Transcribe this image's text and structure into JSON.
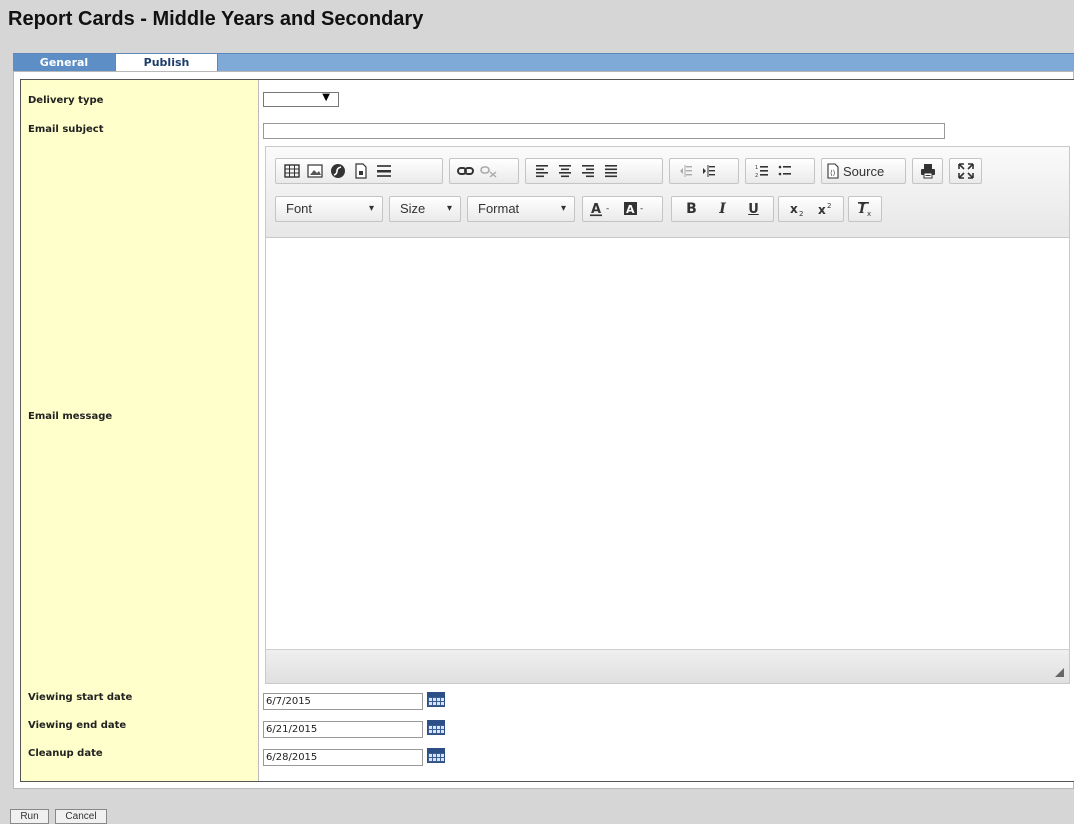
{
  "page": {
    "title": "Report Cards - Middle Years and Secondary"
  },
  "tabs": [
    {
      "label": "General"
    },
    {
      "label": "Publish"
    }
  ],
  "form": {
    "delivery_type": {
      "label": "Delivery type",
      "value": ""
    },
    "email_subject": {
      "label": "Email subject",
      "value": ""
    },
    "email_message": {
      "label": "Email message"
    },
    "viewing_start_date": {
      "label": "Viewing start date",
      "value": "6/7/2015"
    },
    "viewing_end_date": {
      "label": "Viewing end date",
      "value": "6/21/2015"
    },
    "cleanup_date": {
      "label": "Cleanup date",
      "value": "6/28/2015"
    }
  },
  "editor": {
    "source_label": "Source",
    "font_label": "Font",
    "size_label": "Size",
    "format_label": "Format",
    "toolbar_icons": [
      "table-icon",
      "image-icon",
      "flash-icon",
      "page-icon",
      "horizontal-rule-icon",
      "link-icon",
      "unlink-icon",
      "align-left-icon",
      "align-center-icon",
      "align-right-icon",
      "justify-icon",
      "outdent-icon",
      "indent-icon",
      "numbered-list-icon",
      "bulleted-list-icon",
      "source-icon",
      "print-icon",
      "maximize-icon",
      "text-color-icon",
      "background-color-icon",
      "bold-icon",
      "italic-icon",
      "underline-icon",
      "subscript-icon",
      "superscript-icon",
      "remove-format-icon"
    ]
  },
  "buttons": {
    "run": "Run",
    "cancel": "Cancel"
  },
  "colors": {
    "label_bg": "#ffffcc",
    "tab_bar": "#7fa9d6",
    "tab_active_text": "#1d3d6a"
  }
}
